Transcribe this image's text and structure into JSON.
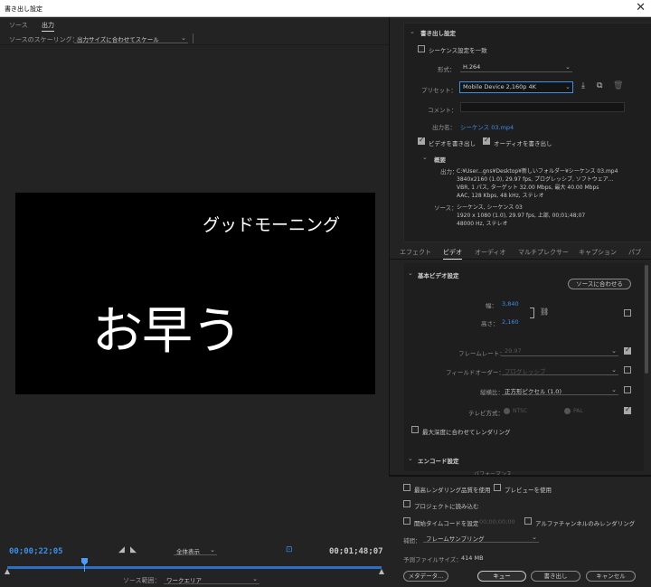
{
  "window": {
    "title": "書き出し設定",
    "close": "✕"
  },
  "left": {
    "tabs": [
      "ソース",
      "出力"
    ],
    "scaling_label": "ソースのスケーリング：",
    "scaling_value": "出力サイズに合わせてスケール",
    "video": {
      "subtitle": "グッドモーニング",
      "main_text": "お早う"
    },
    "timecode_in": "00;00;22;05",
    "timecode_out": "00;01;48;07",
    "zoom_value": "全体表示",
    "source_range_label": "ソース範囲：",
    "source_range_value": "ワークエリア"
  },
  "export": {
    "section_title": "書き出し設定",
    "match_sequence_label": "シーケンス設定を一致",
    "format_label": "形式：",
    "format_value": "H.264",
    "preset_label": "プリセット：",
    "preset_value": "Mobile Device 2,160p 4K",
    "comment_label": "コメント：",
    "output_name_label": "出力名：",
    "output_name_value": "シーケンス 03.mp4",
    "export_video_label": "ビデオを書き出し",
    "export_audio_label": "オーディオを書き出し",
    "summary_title": "概要",
    "output_label": "出力：",
    "output_lines": [
      "C:¥User...gns¥Desktop¥新しいフォルダー¥シーケンス 03.mp4",
      "3840x2160 (1.0), 29.97 fps, プログレッシブ, ソフトウェア...",
      "VBR, 1 パス, ターゲット 32.00 Mbps, 最大 40.00 Mbps",
      "AAC, 128 Kbps, 48 kHz, ステレオ"
    ],
    "source_label": "ソース：",
    "source_lines": [
      "シーケンス, シーケンス 03",
      "1920 x 1080 (1.0), 29.97 fps, 上部, 00;01;48;07",
      "48000 Hz, ステレオ"
    ]
  },
  "rtabs": [
    "エフェクト",
    "ビデオ",
    "オーディオ",
    "マルチプレクサー",
    "キャプション",
    "パブ"
  ],
  "video_settings": {
    "section_title": "基本ビデオ設定",
    "match_source_button": "ソースに合わせる",
    "width_label": "幅：",
    "width_value": "3,840",
    "height_label": "高さ：",
    "height_value": "2,160",
    "frame_rate_label": "フレームレート：",
    "frame_rate_value": "29.97",
    "field_order_label": "フィールドオーダー：",
    "field_order_value": "プログレッシブ",
    "aspect_label": "縦横比：",
    "aspect_value": "正方形ピクセル (1.0)",
    "tv_standard_label": "テレビ方式：",
    "ntsc": "NTSC",
    "pal": "PAL",
    "max_depth_label": "最大深度に合わせてレンダリング",
    "encode_section_title": "エンコード設定",
    "performance_label": "パフォーマンス"
  },
  "bottom": {
    "max_render_label": "最高レンダリング品質を使用",
    "use_preview_label": "プレビューを使用",
    "import_project_label": "プロジェクトに読み込む",
    "start_timecode_label": "開始タイムコードを設定",
    "start_timecode_value": "00;00;00;00",
    "alpha_only_label": "アルファチャンネルのみレンダリング",
    "interp_label": "補間：",
    "interp_value": "フレームサンプリング",
    "file_size_label": "予測ファイルサイズ：",
    "file_size_value": "414 MB",
    "metadata_button": "メタデータ...",
    "queue_button": "キュー",
    "export_button": "書き出し",
    "cancel_button": "キャンセル"
  }
}
